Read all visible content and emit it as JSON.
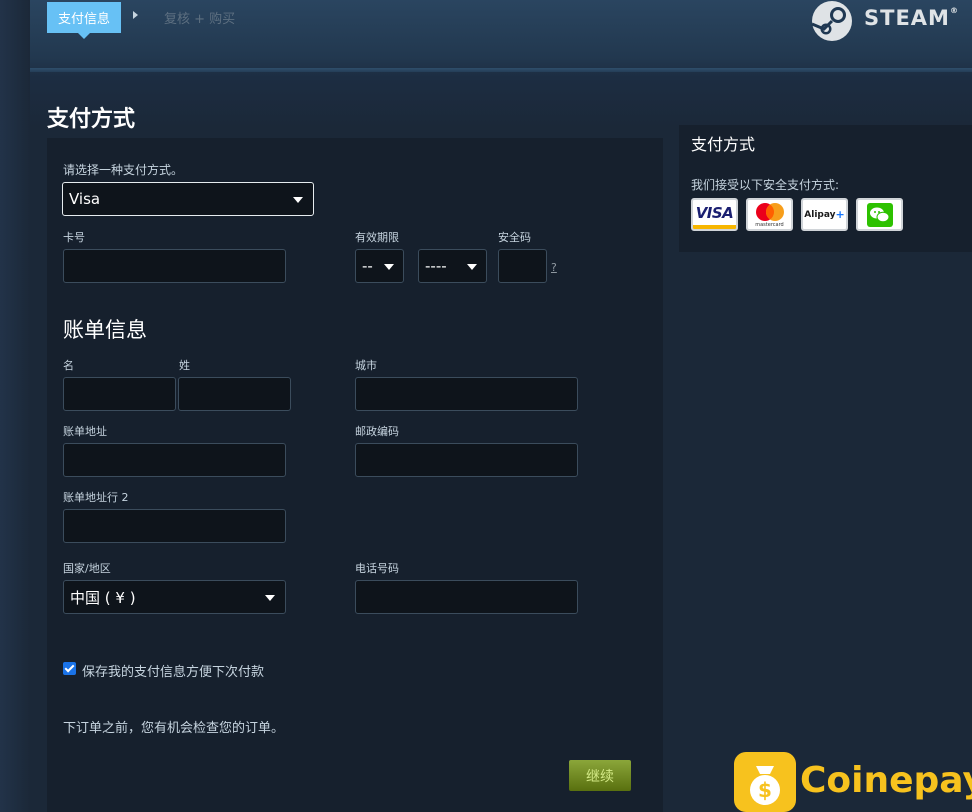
{
  "breadcrumb": {
    "active": "支付信息",
    "next": "复核 + 购买"
  },
  "brand": {
    "name": "STEAM",
    "mark": "®"
  },
  "page_title": "支付方式",
  "payment": {
    "prompt": "请选择一种支付方式。",
    "method_value": "Visa",
    "card_number_label": "卡号",
    "expiry_label": "有效期限",
    "expiry_month_value": "--",
    "expiry_year_value": "----",
    "security_code_label": "安全码",
    "help_link": "?"
  },
  "billing": {
    "title": "账单信息",
    "first_name_label": "名",
    "last_name_label": "姓",
    "city_label": "城市",
    "address_label": "账单地址",
    "postal_label": "邮政编码",
    "address2_label": "账单地址行 2",
    "country_label": "国家/地区",
    "country_value": "中国 ( ¥ )",
    "phone_label": "电话号码"
  },
  "save_info": {
    "label": "保存我的支付信息方便下次付款",
    "checked": true
  },
  "note": "下订单之前，您有机会检查您的订单。",
  "continue_label": "继续",
  "sidebar": {
    "title": "支付方式",
    "text": "我们接受以下安全支付方式:",
    "logos": [
      "VISA",
      "mastercard",
      "Alipay",
      "wechat-pay-icon"
    ]
  },
  "watermark": {
    "name": "Coinepay"
  },
  "colors": {
    "accent": "#67c1f5",
    "background": "#1b2838",
    "panel": "#16202d",
    "button": "#6a8c1f"
  }
}
